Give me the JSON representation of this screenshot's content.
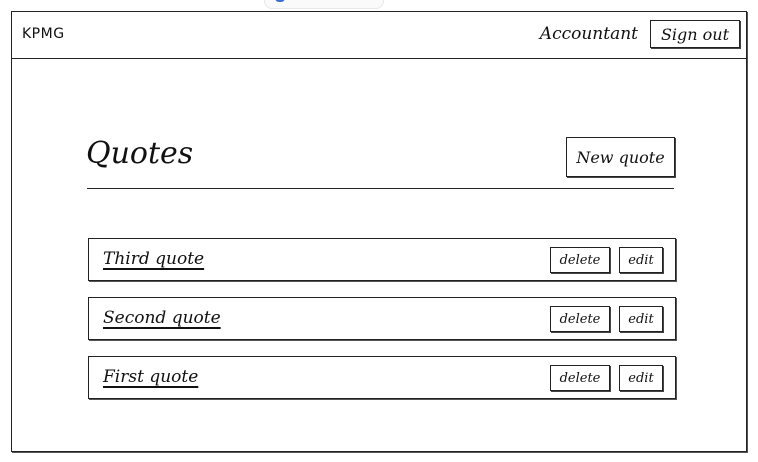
{
  "header": {
    "brand": "KPMG",
    "role": "Accountant",
    "sign_out_label": "Sign out"
  },
  "main": {
    "title": "Quotes",
    "new_quote_label": "New quote",
    "quotes": [
      {
        "title": "Third quote",
        "delete_label": "delete",
        "edit_label": "edit"
      },
      {
        "title": "Second quote",
        "delete_label": "delete",
        "edit_label": "edit"
      },
      {
        "title": "First quote",
        "delete_label": "delete",
        "edit_label": "edit"
      }
    ]
  }
}
